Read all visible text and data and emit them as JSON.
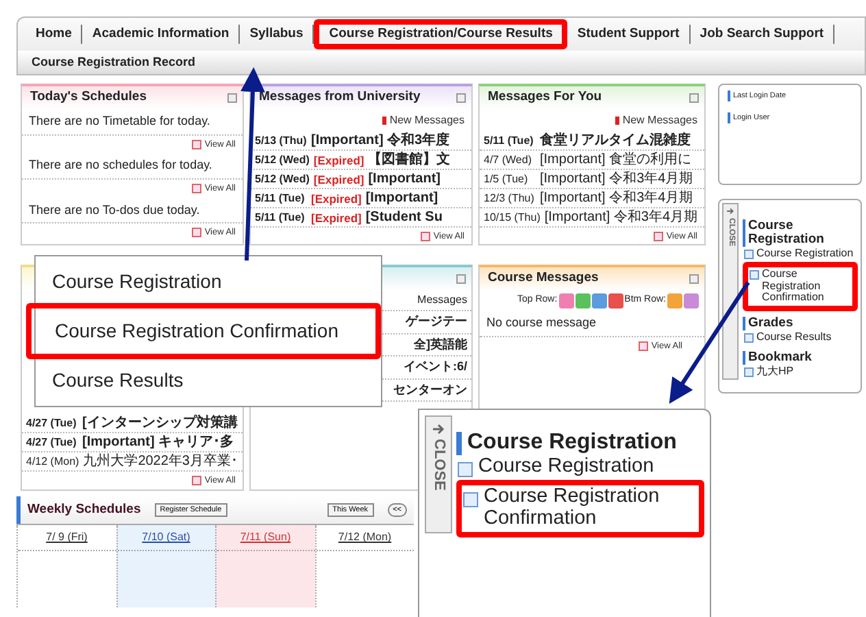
{
  "nav": {
    "tabs": [
      {
        "label": "Home",
        "highlighted": false
      },
      {
        "label": "Academic Information",
        "highlighted": false
      },
      {
        "label": "Syllabus",
        "highlighted": false
      },
      {
        "label": "Course Registration/Course Results",
        "highlighted": true
      },
      {
        "label": "Student Support",
        "highlighted": false
      },
      {
        "label": "Job Search Support",
        "highlighted": false
      }
    ],
    "subnav": [
      "Course Registration Record"
    ]
  },
  "todays_schedules": {
    "title": "Today's Schedules",
    "sections": [
      {
        "text": "There are no Timetable for today.",
        "link": "View All"
      },
      {
        "text": "There are no schedules for today.",
        "link": "View All"
      },
      {
        "text": "There are no To-dos due today.",
        "link": "View All"
      }
    ]
  },
  "messages_from_university": {
    "title": "Messages from University",
    "new_messages": "New Messages",
    "rows": [
      {
        "date": "5/13 (Thu)",
        "expired": "",
        "subject": "[Important] 令和3年度",
        "unread": true
      },
      {
        "date": "5/12 (Wed)",
        "expired": "[Expired]",
        "subject": "【図書館】文",
        "unread": true
      },
      {
        "date": "5/12 (Wed)",
        "expired": "[Expired]",
        "subject": "[Important]",
        "unread": true
      },
      {
        "date": "5/11 (Tue)",
        "expired": "[Expired]",
        "subject": "[Important]",
        "unread": true
      },
      {
        "date": "5/11 (Tue)",
        "expired": "[Expired]",
        "subject": "[Student Su",
        "unread": true
      }
    ],
    "link": "View All"
  },
  "messages_for_you": {
    "title": "Messages For You",
    "new_messages": "New Messages",
    "rows": [
      {
        "date": "5/11 (Tue)",
        "subject": "食堂リアルタイム混雑度",
        "unread": true
      },
      {
        "date": "4/7 (Wed)",
        "subject": "[Important] 食堂の利用に",
        "unread": false
      },
      {
        "date": "1/5 (Tue)",
        "subject": "[Important] 令和3年4月期",
        "unread": false
      },
      {
        "date": "12/3 (Thu)",
        "subject": "[Important] 令和3年4月期",
        "unread": false
      },
      {
        "date": "10/15 (Thu)",
        "subject": "[Important] 令和3年4月期",
        "unread": false
      }
    ],
    "link": "View All"
  },
  "lower_left_panel": {
    "rows": [
      {
        "date": "4/27 (Tue)",
        "subject": "[インターンシップ対策講",
        "unread": true
      },
      {
        "date": "4/27 (Tue)",
        "subject": "[Important] キャリア･多",
        "unread": true
      },
      {
        "date": "4/12 (Mon)",
        "subject": "九州大学2022年3月卒業･",
        "unread": false
      }
    ],
    "link": "View All"
  },
  "lower_middle_panel": {
    "fragments": [
      "Messages",
      "ゲージテー",
      "全]英語能",
      "イベント:6/",
      "センターオン"
    ]
  },
  "course_messages": {
    "title": "Course Messages",
    "top_row_label": "Top Row:",
    "top_row_chips": [
      {
        "color": "#f07fb0"
      },
      {
        "color": "#5cc15c"
      },
      {
        "color": "#5b9be0"
      },
      {
        "color": "#e8504c"
      }
    ],
    "bottom_row_label": "Btm Row:",
    "bottom_row_chips": [
      {
        "color": "#f2a33a"
      },
      {
        "color": "#c98ad8"
      }
    ],
    "text": "No course message",
    "link": "View All"
  },
  "login_box": {
    "items": [
      "Last Login Date",
      "Login User"
    ]
  },
  "side_menu": {
    "close_label": "CLOSE",
    "groups": [
      {
        "heading": "Course Registration",
        "items": [
          {
            "label": "Course Registration",
            "highlighted": false
          },
          {
            "label": "Course Registration Confirmation",
            "highlighted": true
          }
        ]
      },
      {
        "heading": "Grades",
        "items": [
          {
            "label": "Course Results",
            "highlighted": false
          }
        ]
      },
      {
        "heading": "Bookmark",
        "items": [
          {
            "label": "九大HP",
            "highlighted": false
          }
        ]
      }
    ]
  },
  "weekly_schedules": {
    "title": "Weekly Schedules",
    "register_button": "Register Schedule",
    "this_week_button": "This Week",
    "prev_button": "<<",
    "days": [
      {
        "label": "7/ 9 (Fri)",
        "kind": "weekday"
      },
      {
        "label": "7/10 (Sat)",
        "kind": "saturday"
      },
      {
        "label": "7/11 (Sun)",
        "kind": "sunday"
      },
      {
        "label": "7/12 (Mon)",
        "kind": "weekday"
      }
    ]
  },
  "dropdown_callout": {
    "items": [
      {
        "label": "Course Registration",
        "highlighted": false
      },
      {
        "label": "Course Registration Confirmation",
        "highlighted": true
      },
      {
        "label": "Course Results",
        "highlighted": false
      }
    ]
  },
  "side_menu_callout": {
    "close_label": "CLOSE",
    "heading": "Course Registration",
    "items": [
      {
        "label": "Course Registration",
        "highlighted": false
      },
      {
        "label": "Course Registration Confirmation",
        "highlighted": true
      }
    ]
  }
}
